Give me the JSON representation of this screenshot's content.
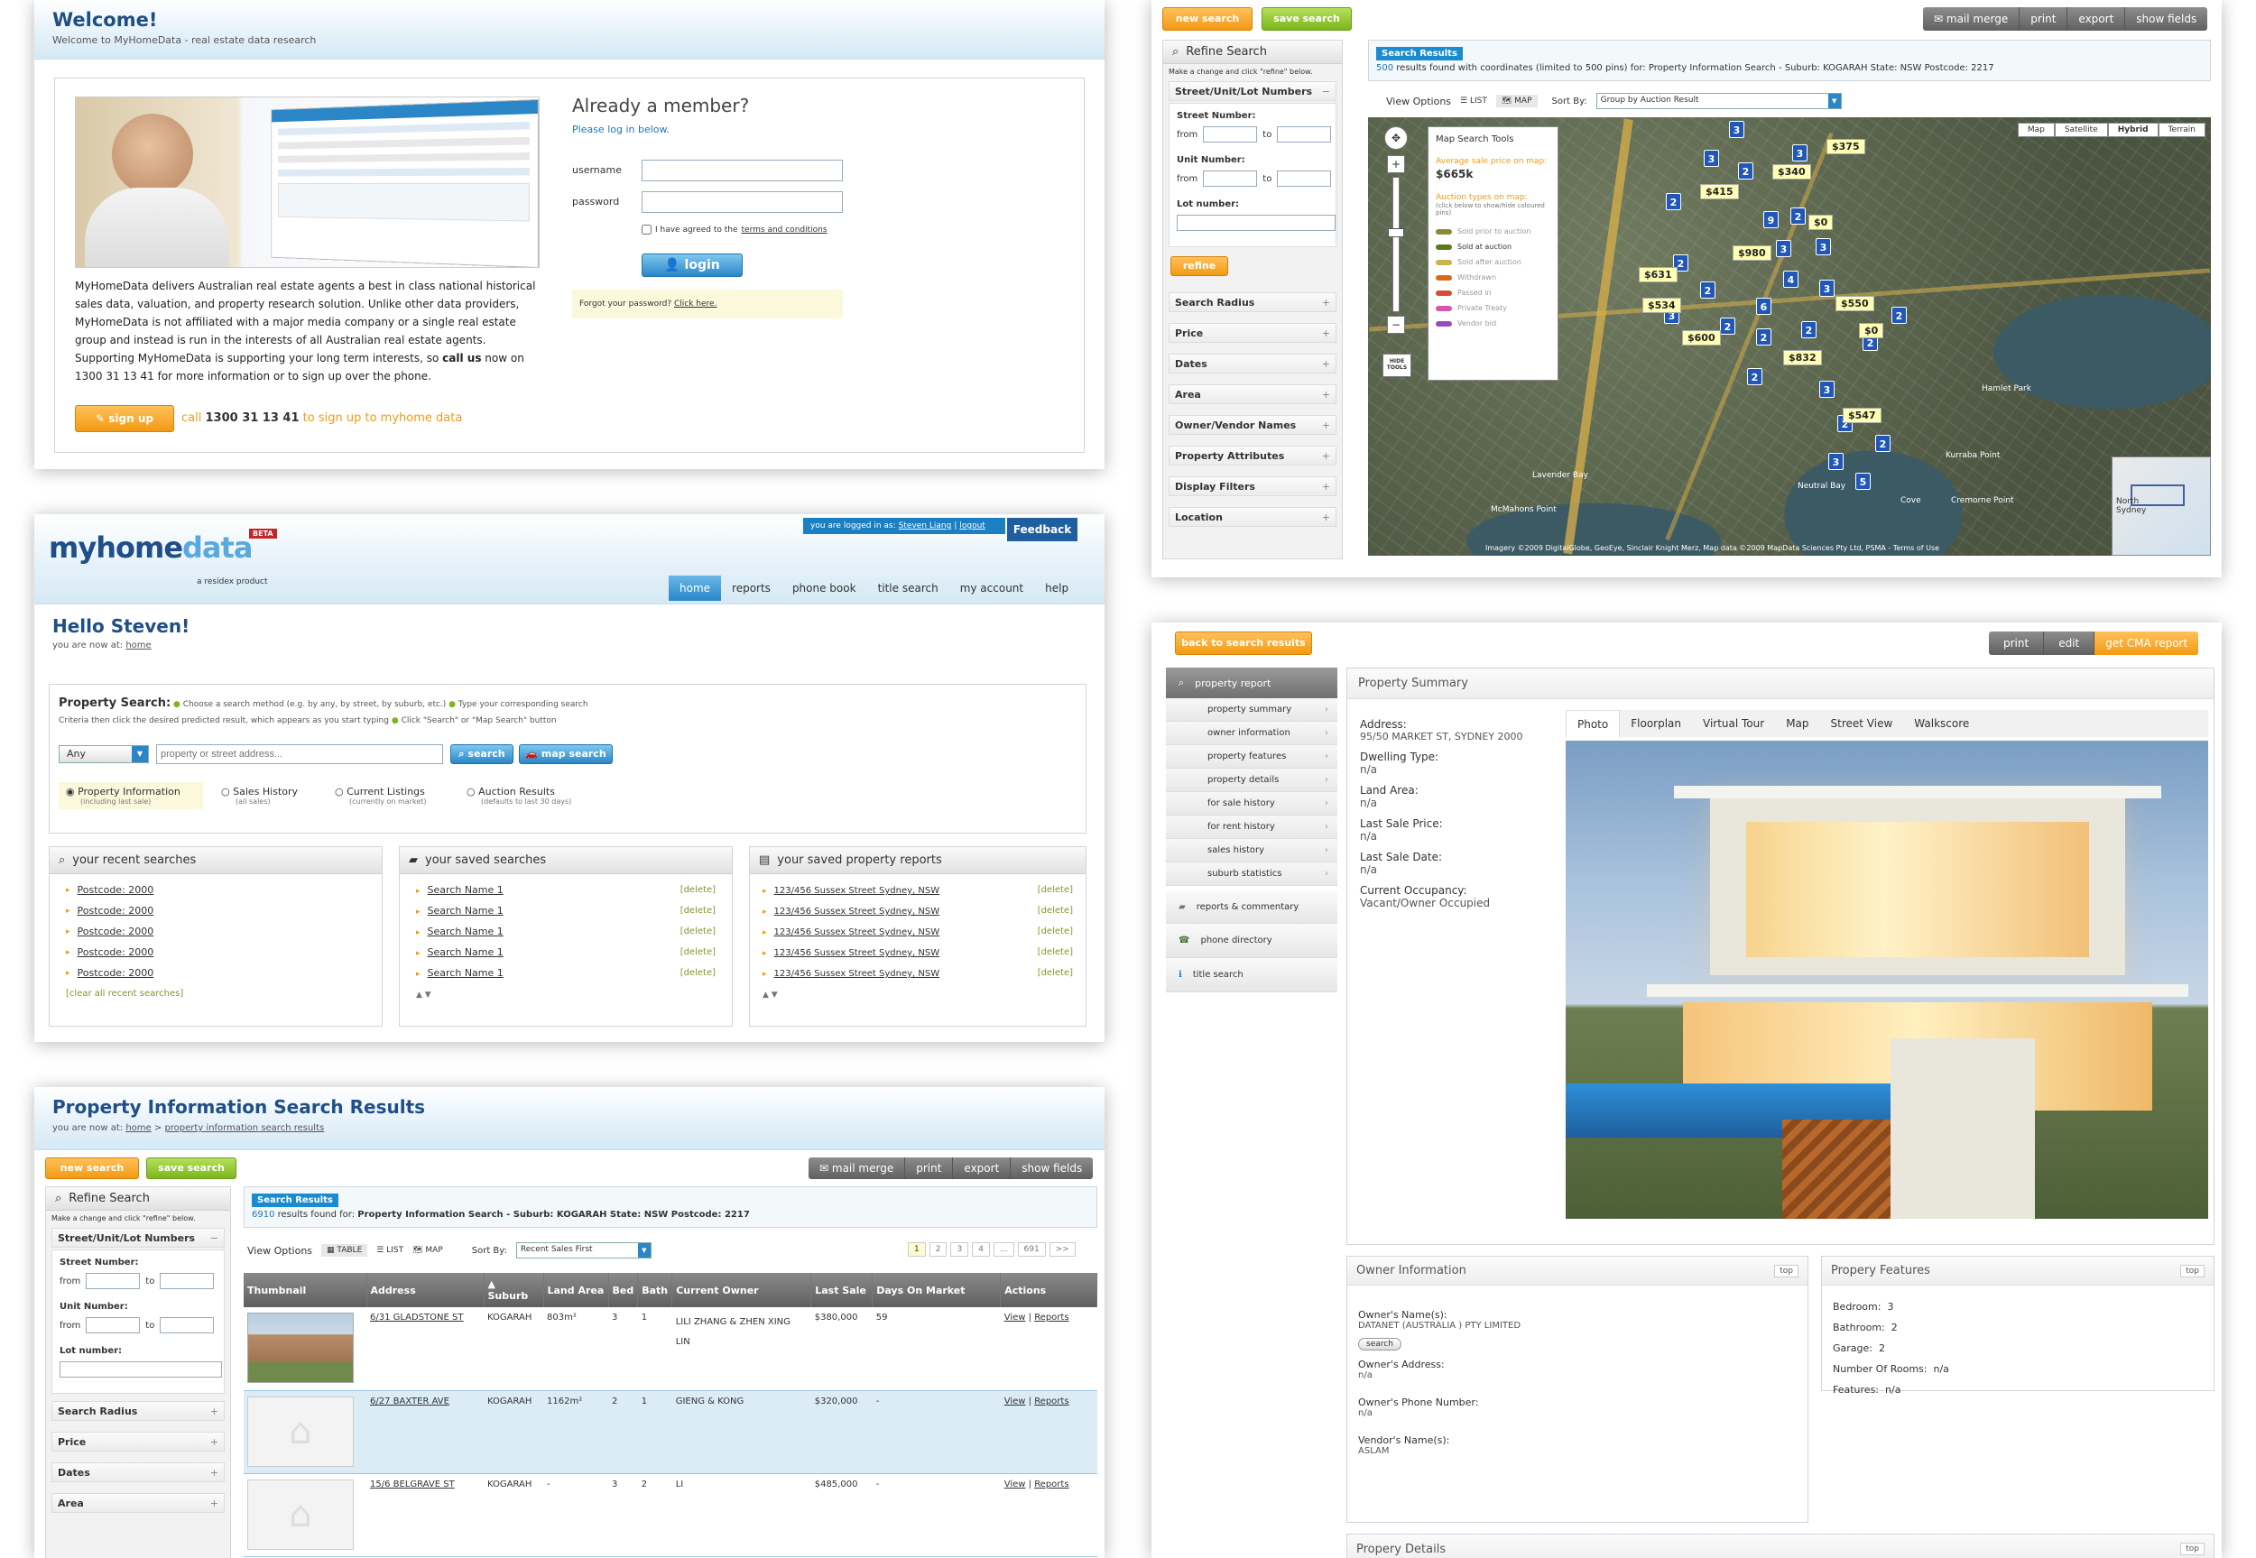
{
  "login": {
    "title": "Welcome!",
    "subtitle": "Welcome to MyHomeData - real estate data research",
    "member_title": "Already a member?",
    "member_sub": "Please log in below.",
    "username_label": "username",
    "password_label": "password",
    "terms_prefix": "I have agreed to the ",
    "terms_link": "terms and conditions",
    "login_button": "login",
    "forgot_prefix": "Forgot your password? ",
    "forgot_link": "Click here.",
    "desc": "MyHomeData delivers Australian real estate agents a best in class national historical sales data, valuation, and property research solution. Unlike other data providers, MyHomeData is not affiliated with a major media company or a single real estate group and instead is run in the interests of all Australian real estate agents. Supporting MyHomeData is supporting your long term interests, so ",
    "desc_bold": "call us",
    "desc_end": " now on 1300 31 13 41 for more information or to sign up over the phone.",
    "signup_button": "sign up",
    "call_prefix": "call ",
    "call_number": "1300 31 13 41",
    "call_suffix": " to sign up to myhome data"
  },
  "home": {
    "logo_text_dark": "myhome",
    "logo_text_light": "data",
    "beta": "BETA",
    "logo_sub": "a residex product",
    "logged_prefix": "you are logged in as: ",
    "user": "Steven Liang",
    "logout": "logout",
    "feedback": "Feedback",
    "nav": [
      "home",
      "reports",
      "phone book",
      "title search",
      "my account",
      "help"
    ],
    "hello": "Hello Steven!",
    "crumb_prefix": "you are now at: ",
    "crumb_link": "home",
    "search_label": "Property Search:",
    "step1": "Choose a search method (e.g. by any, by street, by suburb, etc.)",
    "step2": "Type your corresponding search",
    "step2b": "Criteria then click the desired predicted result, which appears as you start typing",
    "step3": "Click \"Search\" or \"Map Search\" button",
    "select_value": "Any",
    "search_placeholder": "property or street address...",
    "search_button": "search",
    "map_search_button": "map search",
    "radios": [
      {
        "label": "Property Information",
        "sub": "(including last sale)"
      },
      {
        "label": "Sales History",
        "sub": "(all sales)"
      },
      {
        "label": "Current Listings",
        "sub": "(currently on market)"
      },
      {
        "label": "Auction Results",
        "sub": "(defaults to last 30 days)"
      }
    ],
    "recent_title": "your recent searches",
    "recent": [
      "Postcode: 2000",
      "Postcode: 2000",
      "Postcode: 2000",
      "Postcode: 2000",
      "Postcode: 2000"
    ],
    "clear_recent": "[clear all recent searches]",
    "saved_title": "your saved searches",
    "saved": [
      "Search Name 1",
      "Search Name 1",
      "Search Name 1",
      "Search Name 1",
      "Search Name 1"
    ],
    "reports_title": "your saved property reports",
    "reports": [
      "123/456 Sussex Street Sydney, NSW",
      "123/456 Sussex Street Sydney, NSW",
      "123/456 Sussex Street Sydney, NSW",
      "123/456 Sussex Street Sydney, NSW",
      "123/456 Sussex Street Sydney, NSW"
    ],
    "delete_label": "[delete]"
  },
  "results": {
    "title": "Property Information Search Results",
    "crumb_prefix": "you are now at: ",
    "crumb_home": "home",
    "crumb_sep": " > ",
    "crumb_current": "property information search results",
    "new_search": "new search",
    "save_search": "save search",
    "actions": [
      "mail merge",
      "print",
      "export",
      "show fields"
    ],
    "refine_title": "Refine Search",
    "refine_hint": "Make a change and click \"refine\" below.",
    "street_section": "Street/Unit/Lot Numbers",
    "street_number": "Street Number:",
    "unit_number": "Unit Number:",
    "lot_number": "Lot number:",
    "from": "from",
    "to": "to",
    "filters": [
      "Search Radius",
      "Price",
      "Dates",
      "Area"
    ],
    "tag": "Search Results",
    "count": "6910",
    "count_text": " results found for: ",
    "count_query": "Property Information Search - Suburb: KOGARAH State: NSW Postcode: 2217",
    "view_options": "View Options",
    "views": [
      "TABLE",
      "LIST",
      "MAP"
    ],
    "sort_by": "Sort By:",
    "sort_value": "Recent Sales First",
    "pages": [
      "1",
      "2",
      "3",
      "4",
      "...",
      "691",
      ">>"
    ],
    "columns": [
      "Thumbnail",
      "Address",
      "▲ Suburb",
      "Land Area",
      "Bed",
      "Bath",
      "Current Owner",
      "Last Sale",
      "Days On Market",
      "Actions"
    ],
    "rows": [
      {
        "address": "6/31 GLADSTONE ST",
        "suburb": "KOGARAH",
        "land": "803m²",
        "bed": "3",
        "bath": "1",
        "owner": "LILI ZHANG & ZHEN XING LIN",
        "sale": "$380,000",
        "dom": "59",
        "view": "View",
        "reports": "Reports"
      },
      {
        "address": "6/27 BAXTER AVE",
        "suburb": "KOGARAH",
        "land": "1162m²",
        "bed": "2",
        "bath": "1",
        "owner": "GIENG & KONG",
        "sale": "$320,000",
        "dom": "-",
        "view": "View",
        "reports": "Reports"
      },
      {
        "address": "15/6 BELGRAVE ST",
        "suburb": "KOGARAH",
        "land": "-",
        "bed": "3",
        "bath": "2",
        "owner": "LI",
        "sale": "$485,000",
        "dom": "-",
        "view": "View",
        "reports": "Reports"
      }
    ]
  },
  "map": {
    "new_search": "new search",
    "save_search": "save search",
    "actions": [
      "mail merge",
      "print",
      "export",
      "show fields"
    ],
    "refine_title": "Refine Search",
    "refine_hint": "Make a change and click \"refine\" below.",
    "street_section": "Street/Unit/Lot Numbers",
    "street_number": "Street Number:",
    "unit_number": "Unit Number:",
    "lot_number": "Lot number:",
    "from": "from",
    "to": "to",
    "refine_button": "refine",
    "filters": [
      "Search Radius",
      "Price",
      "Dates",
      "Area",
      "Owner/Vendor Names",
      "Property Attributes",
      "Display Filters",
      "Location"
    ],
    "tag": "Search Results",
    "count": "500",
    "count_text": " results found with coordinates (limited to 500 pins) for: Property Information Search - Suburb: KOGARAH State: NSW Postcode: 2217",
    "view_options": "View Options",
    "views": [
      "LIST",
      "MAP"
    ],
    "sort_by": "Sort By:",
    "sort_value": "Group by Auction Result",
    "map_types": [
      "Map",
      "Satellite",
      "Hybrid",
      "Terrain"
    ],
    "tools_title": "Map Search Tools",
    "avg_label": "Average sale price on map:",
    "avg_value": "$665k",
    "auction_title": "Auction types on map:",
    "auction_hint": "(click below to show/hide coloured pins)",
    "legend": [
      {
        "label": "Sold prior to auction",
        "color": "#8a8a3a"
      },
      {
        "label": "Sold at auction",
        "color": "#5b7a1c"
      },
      {
        "label": "Sold after auction",
        "color": "#c8b44a"
      },
      {
        "label": "Withdrawn",
        "color": "#d86a1f"
      },
      {
        "label": "Passed in",
        "color": "#d84a3a"
      },
      {
        "label": "Private Treaty",
        "color": "#d15ab0"
      },
      {
        "label": "Vendor bid",
        "color": "#9a4ab8"
      }
    ],
    "hide_tools": "HIDE TOOLS",
    "prices": [
      "$375",
      "$340",
      "$415",
      "$0",
      "$980",
      "$631",
      "$550",
      "$534",
      "$600",
      "$0",
      "$832",
      "$547"
    ],
    "labels": [
      "North Sydney",
      "Lavender Bay",
      "McMahons Point",
      "Neutral Bay",
      "Cremorne Point",
      "Hamlet Park",
      "Kurraba Point",
      "Cove"
    ],
    "copyright": "Imagery ©2009 DigitalGlobe, GeoEye, Sinclair Knight Merz, Map data ©2009 MapData Sciences Pty Ltd, PSMA - Terms of Use"
  },
  "detail": {
    "back": "back to search results",
    "actions": [
      "print",
      "edit"
    ],
    "cma": "get CMA report",
    "menu_head": "property report",
    "menu": [
      "property summary",
      "owner information",
      "property features",
      "property details",
      "for sale history",
      "for rent history",
      "sales history",
      "suburb statistics"
    ],
    "menu_extra": [
      "reports & commentary",
      "phone directory",
      "title search"
    ],
    "summary_title": "Property Summary",
    "tabs": [
      "Photo",
      "Floorplan",
      "Virtual Tour",
      "Map",
      "Street View",
      "Walkscore"
    ],
    "fields": [
      {
        "label": "Address:",
        "value": "95/50 MARKET ST, SYDNEY 2000"
      },
      {
        "label": "Dwelling Type:",
        "value": "n/a"
      },
      {
        "label": "Land Area:",
        "value": "n/a"
      },
      {
        "label": "Last Sale Price:",
        "value": "n/a"
      },
      {
        "label": "Last Sale Date:",
        "value": "n/a"
      },
      {
        "label": "Current Occupancy:",
        "value": "Vacant/Owner Occupied"
      }
    ],
    "owner_title": "Owner Information",
    "top": "top",
    "owner_name_label": "Owner's Name(s):",
    "owner_name": "DATANET (AUSTRALIA ) PTY LIMITED",
    "search_btn": "search",
    "owner_addr_label": "Owner's Address:",
    "owner_addr": "n/a",
    "owner_phone_label": "Owner's Phone Number:",
    "owner_phone": "n/a",
    "vendor_label": "Vendor's Name(s):",
    "vendor": "ASLAM",
    "features_title": "Propery Features",
    "features": [
      {
        "label": "Bedroom:",
        "value": "3"
      },
      {
        "label": "Bathroom:",
        "value": "2"
      },
      {
        "label": "Garage:",
        "value": "2"
      },
      {
        "label": "Number Of Rooms:",
        "value": "n/a"
      },
      {
        "label": "Features:",
        "value": "n/a"
      }
    ],
    "details_title": "Propery Details"
  }
}
